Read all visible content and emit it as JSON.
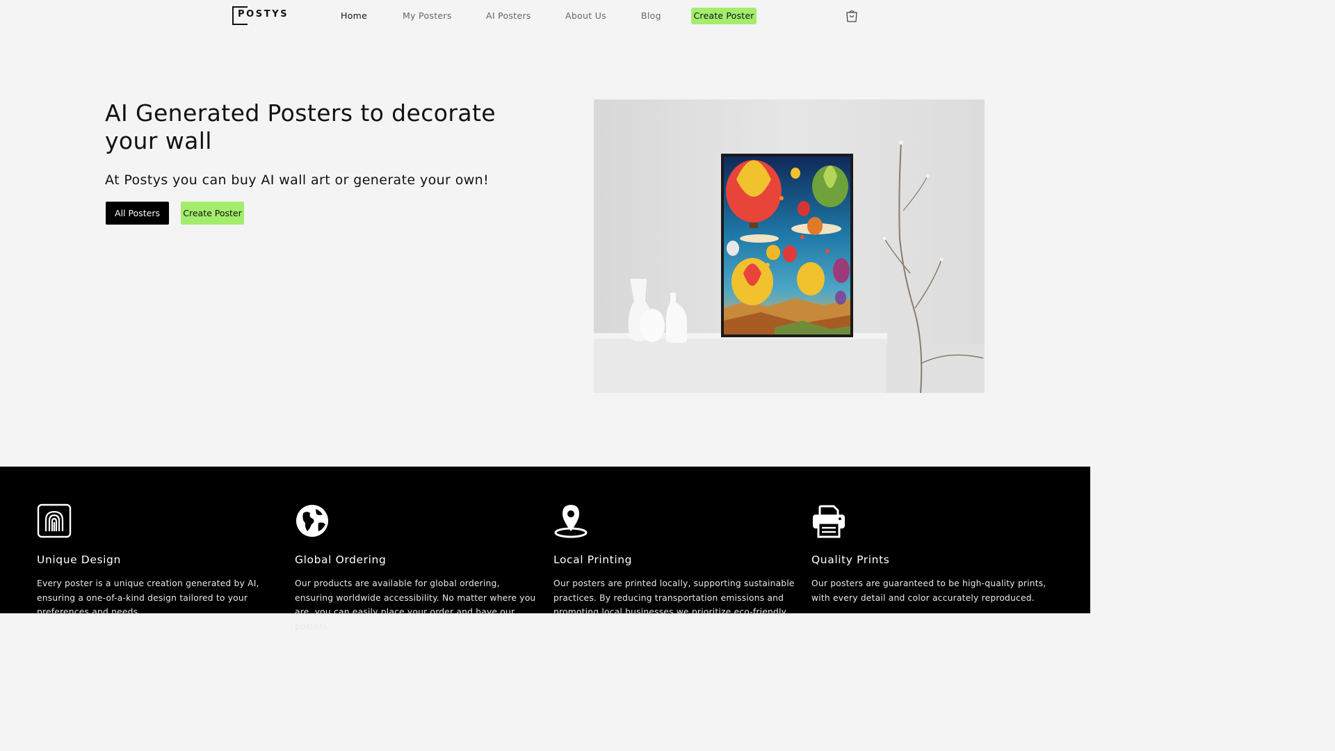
{
  "brand": {
    "logo_text": "POSTYS"
  },
  "nav": {
    "links": [
      "Home",
      "My Posters",
      "AI Posters",
      "About Us",
      "Blog"
    ],
    "cta": "Create Poster",
    "cart_icon": "shopping-bag-icon"
  },
  "hero": {
    "title": "AI Generated Posters to decorate your wall",
    "subtitle": "At Postys you can buy AI wall art or generate your own!",
    "primary_button": "All Posters",
    "secondary_button": "Create Poster"
  },
  "features": [
    {
      "icon": "fingerprint-icon",
      "title": "Unique Design",
      "desc": "Every poster is a unique creation generated by AI, ensuring a one-of-a-kind design tailored to your preferences and needs."
    },
    {
      "icon": "globe-icon",
      "title": "Global Ordering",
      "desc": "Our products are available for global ordering, ensuring worldwide accessibility. No matter where you are, you can easily place your order and have our posters"
    },
    {
      "icon": "map-pin-icon",
      "title": "Local Printing",
      "desc": "Our posters are printed locally, supporting sustainable practices. By reducing transportation emissions and promoting local businesses we prioritize eco-friendly"
    },
    {
      "icon": "printer-icon",
      "title": "Quality Prints",
      "desc": "Our posters are guaranteed to be high-quality prints, with every detail and color accurately reproduced."
    }
  ],
  "colors": {
    "accent_green": "#a3ec6c",
    "dark": "#000000",
    "background": "#f4f4f4"
  }
}
